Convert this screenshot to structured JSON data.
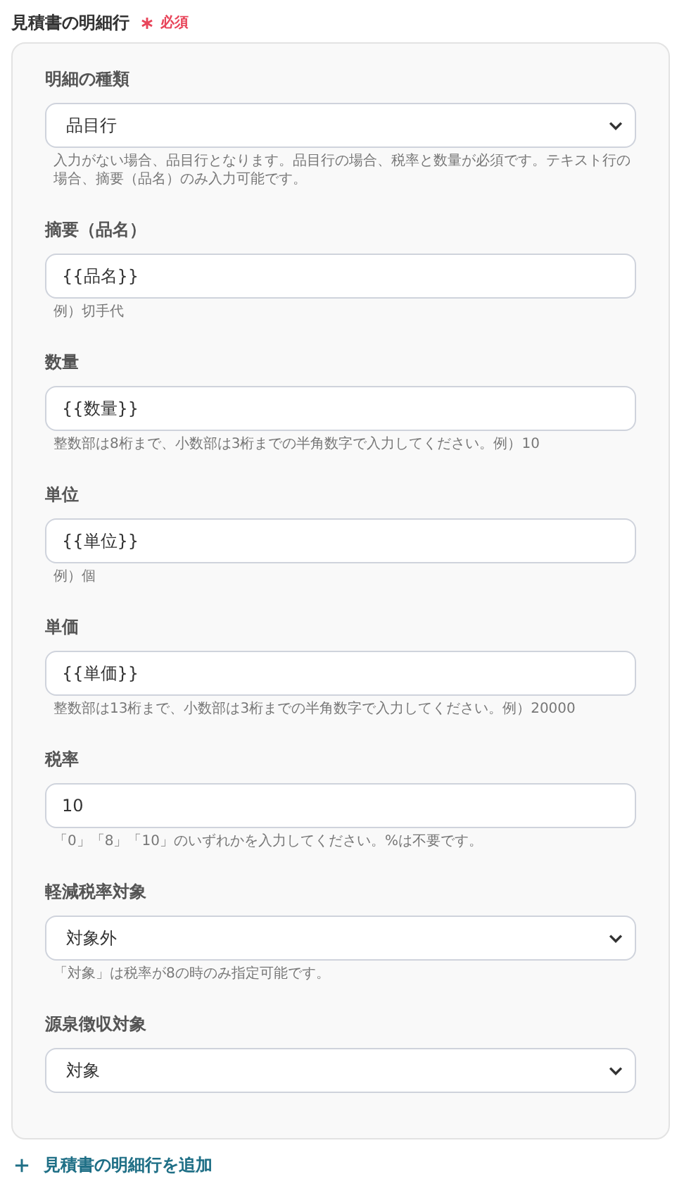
{
  "section": {
    "title": "見積書の明細行",
    "required": true,
    "required_label": "必須"
  },
  "fields": [
    {
      "kind": "select",
      "label": "明細の種類",
      "value": "品目行",
      "help": "入力がない場合、品目行となります。品目行の場合、税率と数量が必須です。テキスト行の場合、摘要（品名）のみ入力可能です。"
    },
    {
      "kind": "text",
      "label": "摘要（品名）",
      "value": "{{品名}}",
      "help": "例）切手代"
    },
    {
      "kind": "text",
      "label": "数量",
      "value": "{{数量}}",
      "help": "整数部は8桁まで、小数部は3桁までの半角数字で入力してください。例）10"
    },
    {
      "kind": "text",
      "label": "単位",
      "value": "{{単位}}",
      "help": "例）個"
    },
    {
      "kind": "text",
      "label": "単価",
      "value": "{{単価}}",
      "help": "整数部は13桁まで、小数部は3桁までの半角数字で入力してください。例）20000"
    },
    {
      "kind": "text",
      "label": "税率",
      "value": "10",
      "help": "「0」「8」「10」のいずれかを入力してください。%は不要です。"
    },
    {
      "kind": "select",
      "label": "軽減税率対象",
      "value": "対象外",
      "help": "「対象」は税率が8の時のみ指定可能です。"
    },
    {
      "kind": "select",
      "label": "源泉徴収対象",
      "value": "対象"
    }
  ],
  "add_link": "見積書の明細行を追加"
}
